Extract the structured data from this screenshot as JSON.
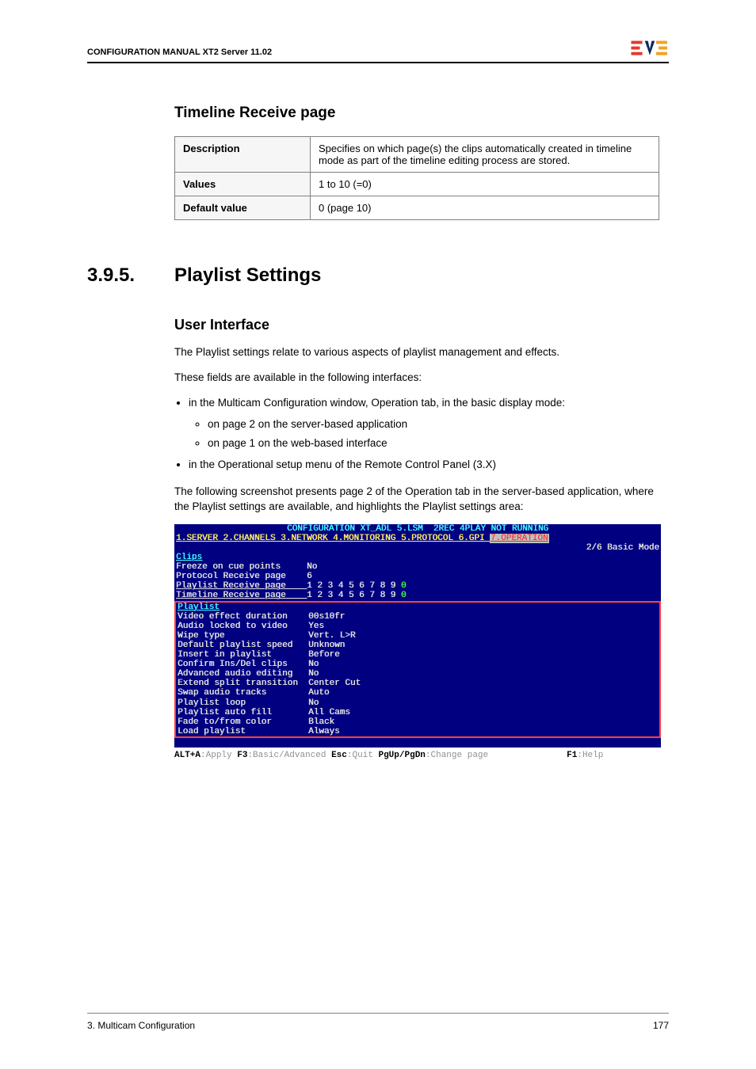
{
  "header": {
    "title": "CONFIGURATION MANUAL   XT2 Server 11.02"
  },
  "section": {
    "title": "Timeline Receive page"
  },
  "param_table": [
    {
      "label": "Description",
      "value": "Specifies on which page(s) the clips automatically created in timeline mode as part of the timeline editing process are stored."
    },
    {
      "label": "Values",
      "value": "1 to 10 (=0)"
    },
    {
      "label": "Default value",
      "value": "0 (page 10)"
    }
  ],
  "chapter": {
    "number": "3.9.5.",
    "title": "Playlist Settings"
  },
  "subsection": {
    "title": "User Interface"
  },
  "paragraphs": {
    "p1": "The Playlist settings relate to various aspects of playlist management and effects.",
    "p2": "These fields are available in the following interfaces:",
    "p3": "The following screenshot presents page 2 of the Operation tab in the server-based application, where the Playlist settings are available, and highlights the Playlist settings area:"
  },
  "bullets": {
    "b1": "in the Multicam Configuration window, Operation tab, in the basic display mode:",
    "b1a": "on page 2 on the server-based application",
    "b1b": "on page 1 on the web-based interface",
    "b2": "in the Operational setup menu of the Remote Control Panel (3.X)"
  },
  "terminal": {
    "title": "CONFIGURATION XT_ADL 5.LSM  2REC 4PLAY NOT RUNNING",
    "tabs": "1.SERVER 2.CHANNELS 3.NETWORK 4.MONITORING 5.PROTOCOL 6.GPI ",
    "tab_active": "7.OPERATION",
    "mode": "2/6 Basic Mode",
    "clips_header": "Clips",
    "clips": [
      {
        "label": "Freeze on cue points",
        "value": "No"
      },
      {
        "label": "Protocol Receive page",
        "value": "6"
      },
      {
        "label": "Playlist Receive page",
        "value": "1 2 3 4 5 6 7 8 9 0"
      },
      {
        "label": "Timeline Receive page",
        "value": "1 2 3 4 5 6 7 8 9 0"
      }
    ],
    "playlist_header": "Playlist",
    "playlist": [
      {
        "label": "Video effect duration",
        "value": "00s10fr"
      },
      {
        "label": "Audio locked to video",
        "value": "Yes"
      },
      {
        "label": "Wipe type",
        "value": "Vert. L>R"
      },
      {
        "label": "Default playlist speed",
        "value": "Unknown"
      },
      {
        "label": "Insert in playlist",
        "value": "Before"
      },
      {
        "label": "Confirm Ins/Del clips",
        "value": "No"
      },
      {
        "label": "Advanced audio editing",
        "value": "No"
      },
      {
        "label": "Extend split transition",
        "value": "Center Cut"
      },
      {
        "label": "Swap audio tracks",
        "value": "Auto"
      },
      {
        "label": "Playlist loop",
        "value": "No"
      },
      {
        "label": "Playlist auto fill",
        "value": "All Cams"
      },
      {
        "label": "Fade to/from color",
        "value": "Black"
      },
      {
        "label": "Load playlist",
        "value": "Always"
      }
    ],
    "footer": {
      "k1": "ALT+A",
      "v1": ":Apply ",
      "k2": "F3",
      "v2": ":Basic/Advanced ",
      "k3": "Esc",
      "v3": ":Quit ",
      "k4": "PgUp/PgDn",
      "v4": ":Change page",
      "pad": "               ",
      "k5": "F1",
      "v5": ":Help"
    }
  },
  "page_footer": {
    "left": "3. Multicam Configuration",
    "right": "177"
  }
}
